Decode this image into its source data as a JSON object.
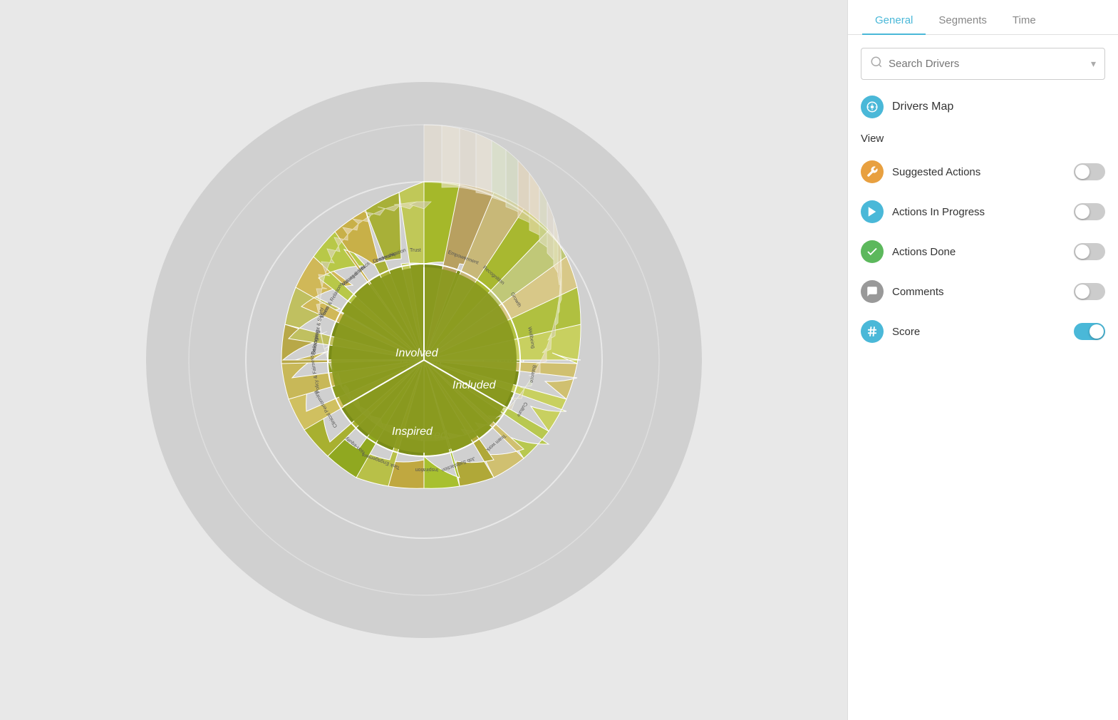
{
  "tabs": [
    {
      "id": "general",
      "label": "General",
      "active": true
    },
    {
      "id": "segments",
      "label": "Segments",
      "active": false
    },
    {
      "id": "time",
      "label": "Time",
      "active": false
    }
  ],
  "search": {
    "placeholder": "Search Drivers"
  },
  "drivers_map": {
    "label": "Drivers Map"
  },
  "view": {
    "label": "View",
    "items": [
      {
        "id": "suggested",
        "label": "Suggested Actions",
        "icon": "wrench",
        "color": "orange",
        "toggled": false
      },
      {
        "id": "in_progress",
        "label": "Actions In Progress",
        "icon": "arrow",
        "color": "blue",
        "toggled": false
      },
      {
        "id": "done",
        "label": "Actions Done",
        "icon": "check",
        "color": "green",
        "toggled": false
      },
      {
        "id": "comments",
        "label": "Comments",
        "icon": "bubble",
        "color": "gray",
        "toggled": false
      },
      {
        "id": "score",
        "label": "Score",
        "icon": "hash",
        "color": "teal",
        "toggled": true
      }
    ]
  },
  "chart": {
    "center_labels": [
      "Involved",
      "Included",
      "Inspired"
    ]
  }
}
